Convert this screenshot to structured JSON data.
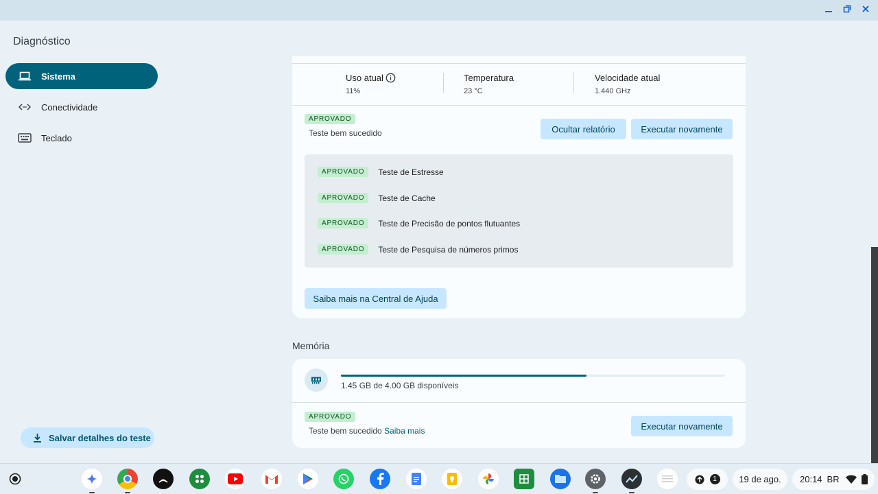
{
  "window": {
    "minimize_icon": "minimize-icon",
    "restore_icon": "restore-icon",
    "close_icon": "close-icon"
  },
  "app": {
    "title": "Diagnóstico"
  },
  "sidebar": {
    "items": [
      {
        "label": "Sistema",
        "icon": "laptop-icon",
        "active": true
      },
      {
        "label": "Conectividade",
        "icon": "code-arrows-icon",
        "active": false
      },
      {
        "label": "Teclado",
        "icon": "keyboard-icon",
        "active": false
      }
    ],
    "save_label": "Salvar detalhes do teste"
  },
  "cpu": {
    "metrics": [
      {
        "label": "Uso atual",
        "value": "11%"
      },
      {
        "label": "Temperatura",
        "value": "23 °C"
      },
      {
        "label": "Velocidade atual",
        "value": "1.440 GHz"
      }
    ],
    "status_badge": "APROVADO",
    "status_text": "Teste bem sucedido",
    "hide_report_label": "Ocultar relatório",
    "rerun_label": "Executar novamente",
    "tests": [
      {
        "badge": "APROVADO",
        "name": "Teste de Estresse"
      },
      {
        "badge": "APROVADO",
        "name": "Teste de Cache"
      },
      {
        "badge": "APROVADO",
        "name": "Teste de Precisão de pontos flutuantes"
      },
      {
        "badge": "APROVADO",
        "name": "Teste de Pesquisa de números primos"
      }
    ],
    "help_label": "Saiba mais na Central de Ajuda"
  },
  "memory": {
    "section_title": "Memória",
    "available_text": "1.45 GB de 4.00 GB disponíveis",
    "used_fraction": 0.64,
    "status_badge": "APROVADO",
    "status_text": "Teste bem sucedido",
    "learn_more": "Saiba mais",
    "rerun_label": "Executar novamente"
  },
  "shelf": {
    "apps": [
      "launcher-icon",
      "gemini-icon",
      "chrome-icon",
      "podcasts-icon",
      "apps-icon",
      "youtube-icon",
      "gmail-icon",
      "play-store-icon",
      "whatsapp-icon",
      "facebook-icon",
      "docs-icon",
      "keep-icon",
      "photos-icon",
      "sheets-icon",
      "files-icon",
      "settings-icon",
      "diagnostics-icon",
      "notes-icon"
    ],
    "notification_count": "1",
    "date": "19 de ago.",
    "time": "20:14",
    "locale": "BR"
  },
  "colors": {
    "accent": "#00637b",
    "button": "#c6e7ff",
    "badge_bg": "#c4eed0",
    "progress": "#00637b"
  }
}
